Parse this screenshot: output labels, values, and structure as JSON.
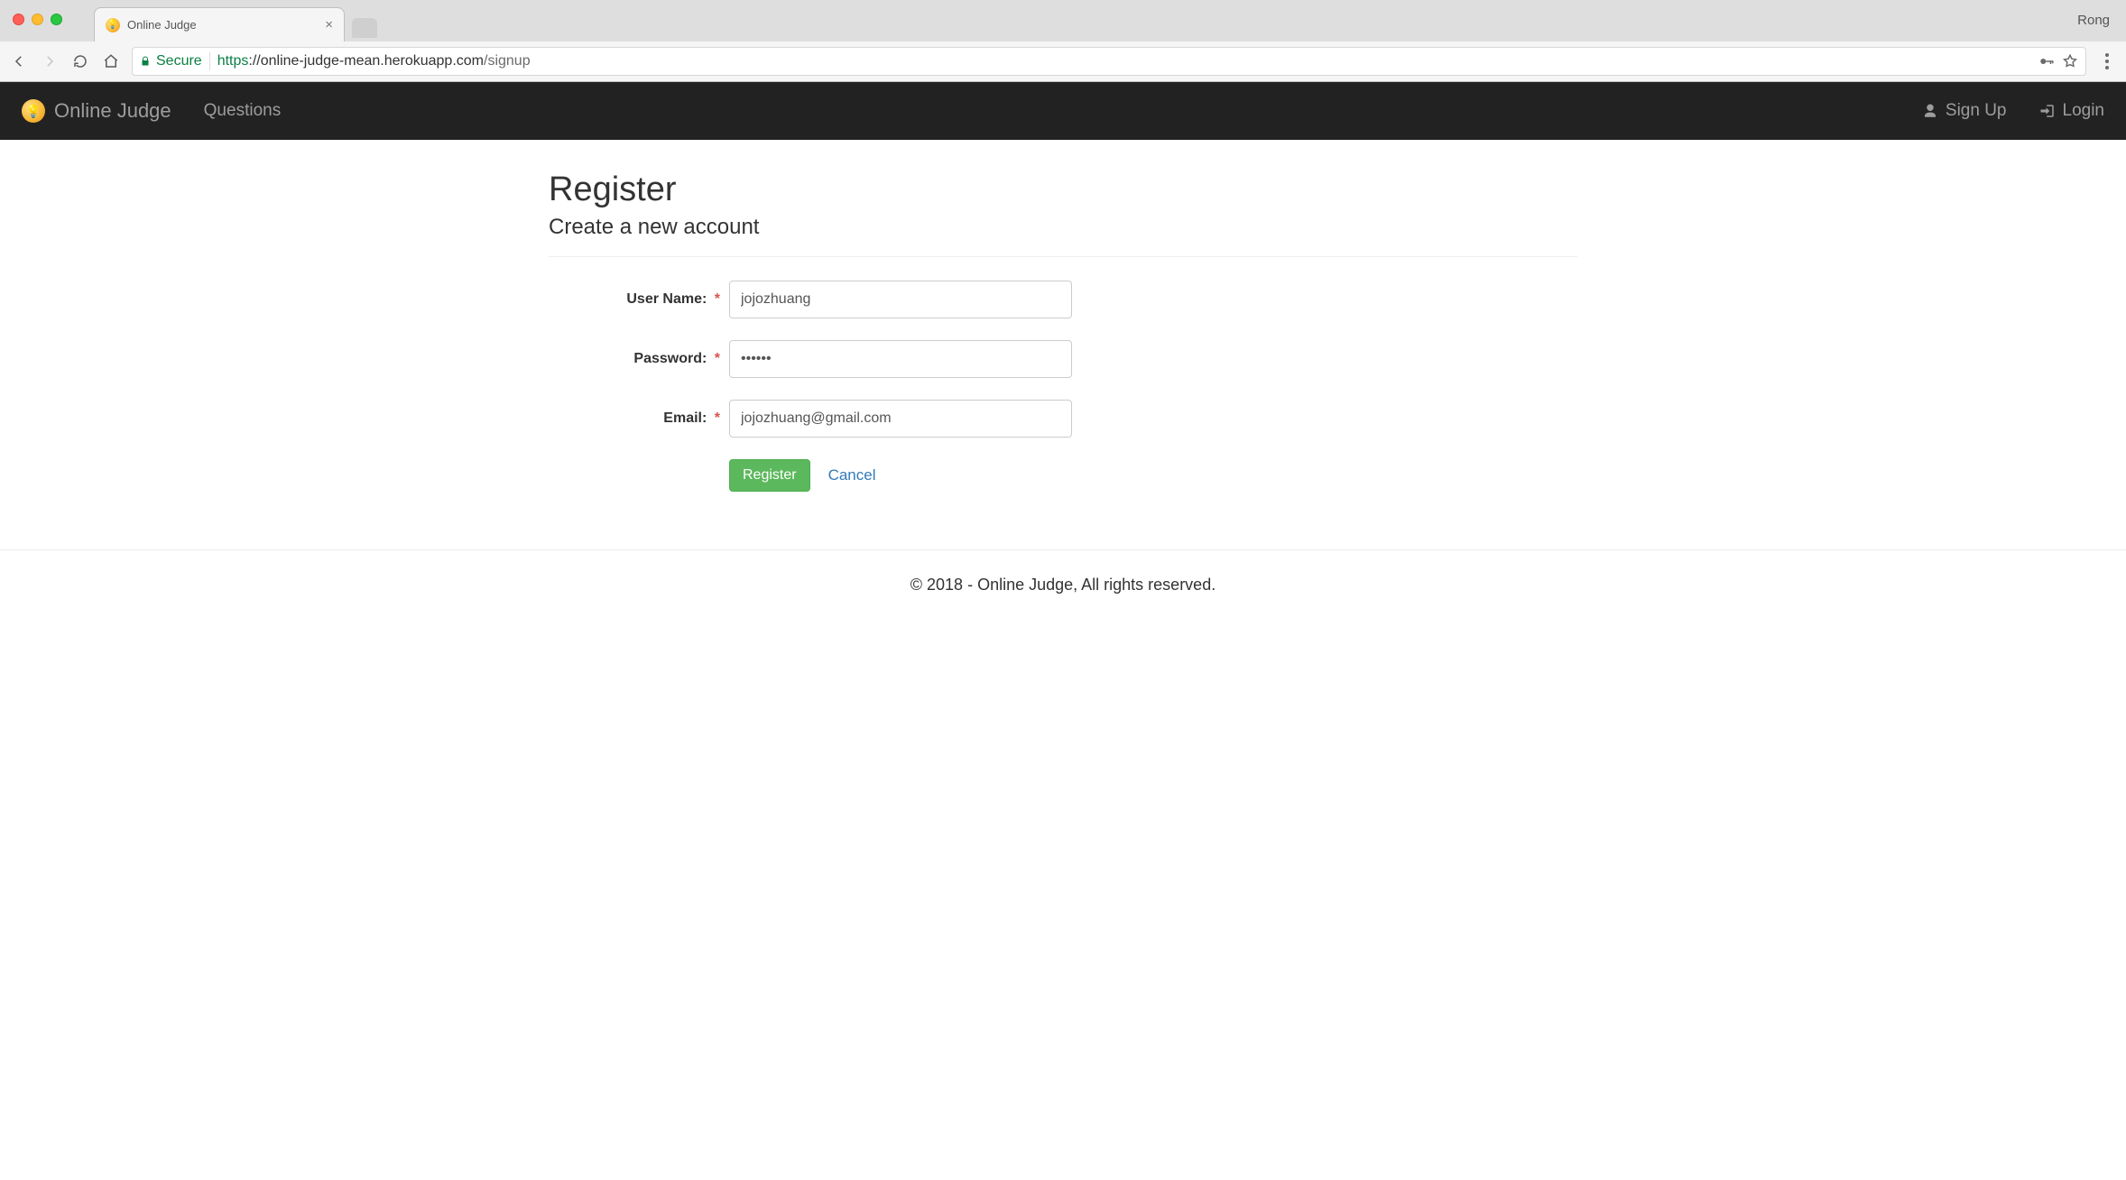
{
  "browser": {
    "profile_name": "Rong",
    "tab_title": "Online Judge",
    "secure_label": "Secure",
    "url_scheme": "https",
    "url_host": "://online-judge-mean.herokuapp.com",
    "url_path": "/signup"
  },
  "navbar": {
    "brand": "Online Judge",
    "items": [
      "Questions"
    ],
    "signup": "Sign Up",
    "login": "Login"
  },
  "page": {
    "title": "Register",
    "subtitle": "Create a new account"
  },
  "form": {
    "username_label": "User Name:",
    "username_value": "jojozhuang",
    "password_label": "Password:",
    "password_value": "••••••",
    "email_label": "Email:",
    "email_value": "jojozhuang@gmail.com",
    "required_marker": "*",
    "submit_label": "Register",
    "cancel_label": "Cancel"
  },
  "footer": {
    "text": "© 2018 - Online Judge, All rights reserved."
  }
}
